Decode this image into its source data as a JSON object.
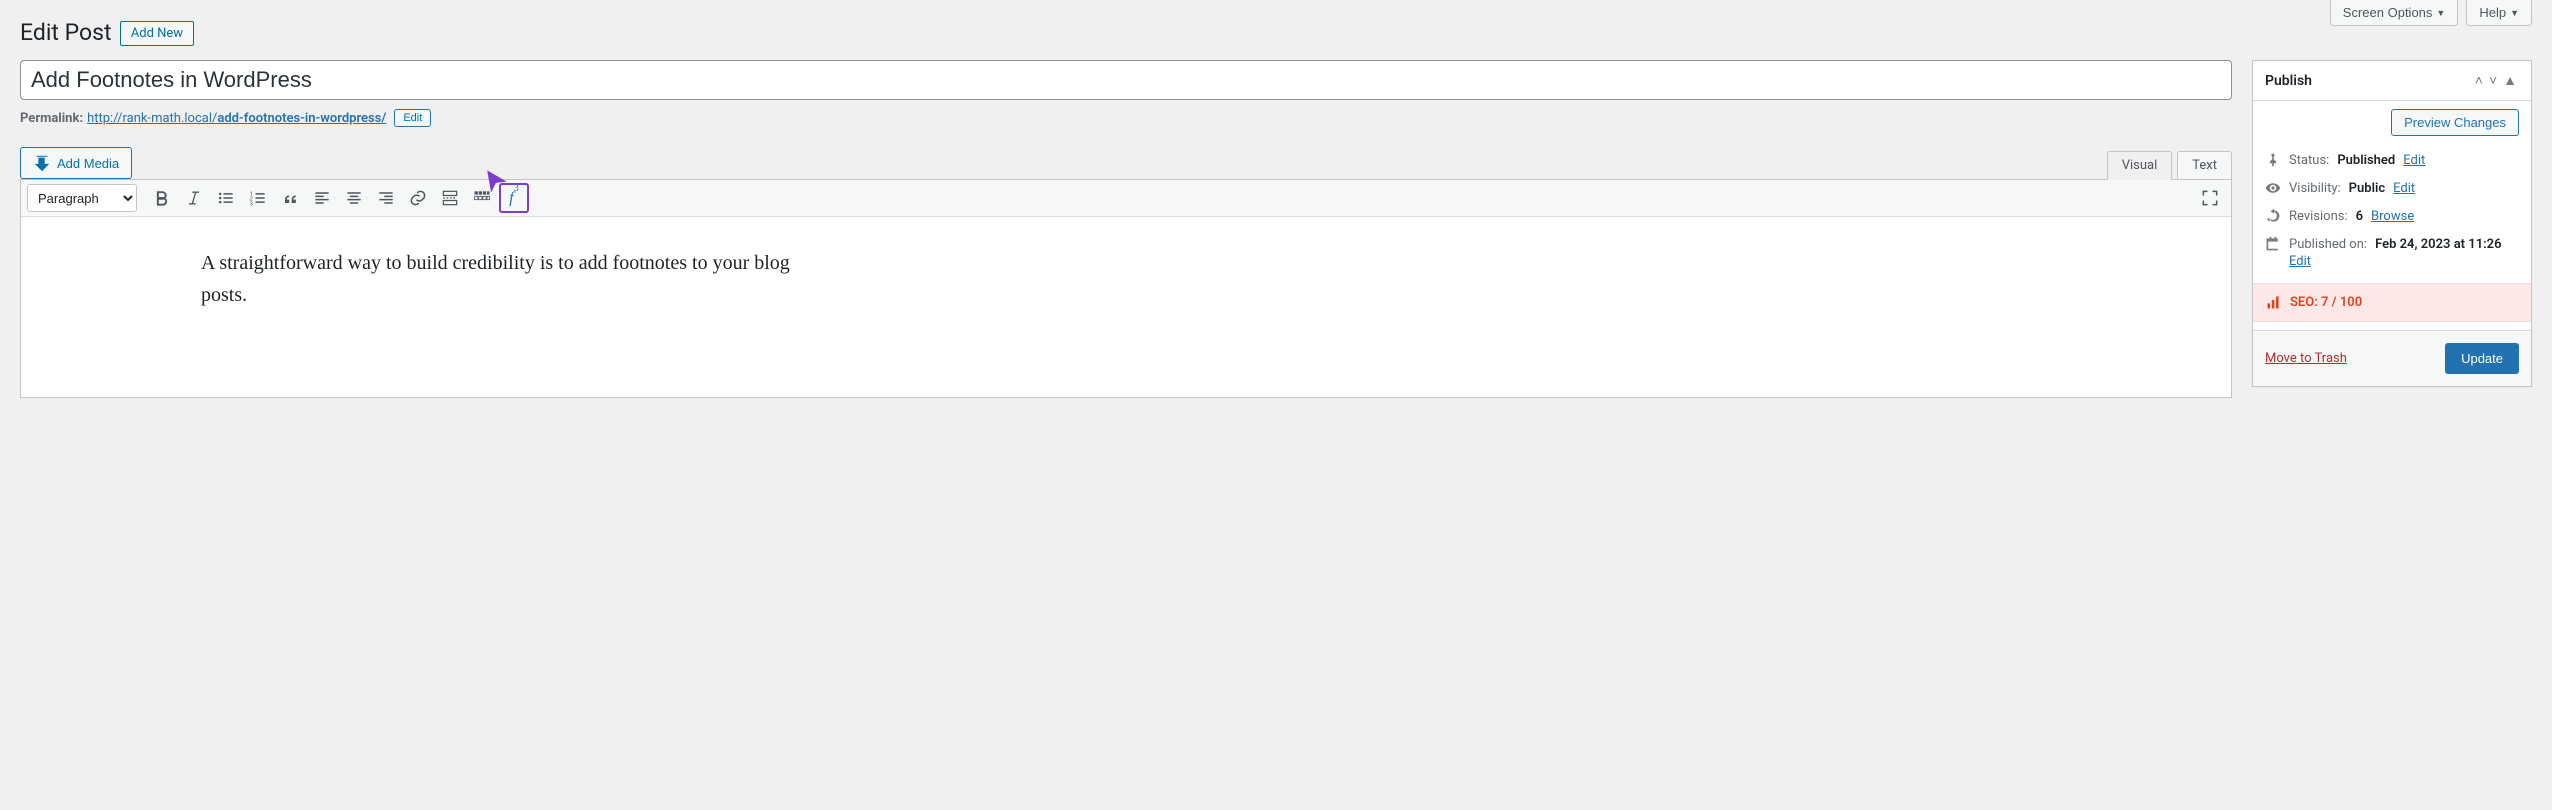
{
  "top": {
    "screen_options": "Screen Options",
    "help": "Help"
  },
  "heading": "Edit Post",
  "add_new": "Add New",
  "title_value": "Add Footnotes in WordPress",
  "permalink": {
    "label": "Permalink:",
    "base": "http://rank-math.local/",
    "slug": "add-footnotes-in-wordpress/",
    "edit": "Edit"
  },
  "add_media": "Add Media",
  "tabs": {
    "visual": "Visual",
    "text": "Text"
  },
  "format_select": "Paragraph",
  "footnote_btn_label": "f",
  "footnote_btn_sup": "3",
  "editor_body": "A straightforward way to build credibility is to add footnotes to your blog posts.",
  "publish": {
    "title": "Publish",
    "preview": "Preview Changes",
    "status_label": "Status:",
    "status_value": "Published",
    "visibility_label": "Visibility:",
    "visibility_value": "Public",
    "revisions_label": "Revisions:",
    "revisions_value": "6",
    "browse": "Browse",
    "published_label": "Published on:",
    "published_value": "Feb 24, 2023 at 11:26",
    "edit_link": "Edit",
    "seo": "SEO: 7 / 100",
    "trash": "Move to Trash",
    "update": "Update"
  }
}
